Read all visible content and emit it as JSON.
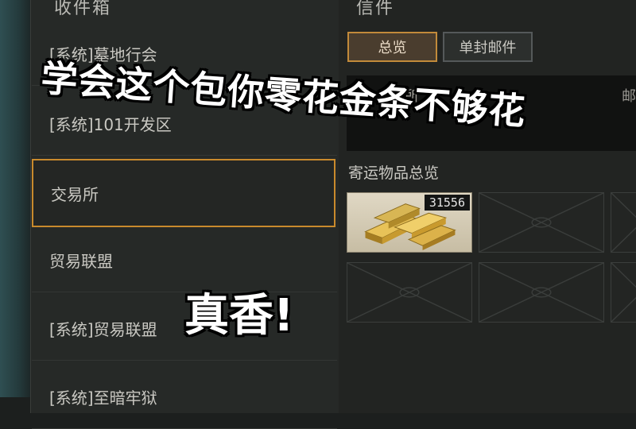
{
  "inbox": {
    "header": "收件箱",
    "items": [
      {
        "label": "[系统]墓地行会",
        "active": false
      },
      {
        "label": "[系统]101开发区",
        "active": false
      },
      {
        "label": "交易所",
        "active": true
      },
      {
        "label": "贸易联盟",
        "active": false
      },
      {
        "label": "[系统]贸易联盟",
        "active": false
      },
      {
        "label": "[系统]至暗牢狱",
        "active": false
      }
    ]
  },
  "mail": {
    "header": "信件",
    "tabs": [
      {
        "label": "总览",
        "active": true
      },
      {
        "label": "单封邮件",
        "active": false
      }
    ],
    "sender_fragment": "易所",
    "mail_fragment": "邮",
    "section_title": "寄运物品总览",
    "slots": [
      {
        "item": "gold-bars",
        "count": "31556"
      },
      {
        "item": "empty",
        "count": ""
      },
      {
        "item": "empty",
        "count": ""
      },
      {
        "item": "empty",
        "count": ""
      },
      {
        "item": "empty",
        "count": ""
      },
      {
        "item": "empty",
        "count": ""
      }
    ]
  },
  "captions": {
    "top": "学会这个包你零花金条不够花",
    "bottom": "真香!"
  },
  "colors": {
    "active_border": "#c98a2c",
    "panel_bg": "#262927",
    "gold": "#d4b04a"
  }
}
